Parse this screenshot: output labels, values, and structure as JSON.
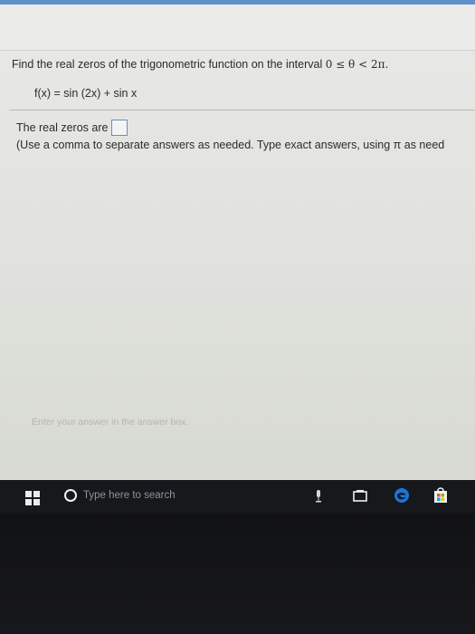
{
  "question": {
    "prefix": "Find the real zeros of the trigonometric function on the interval ",
    "interval": "0 ≤ θ < 2π."
  },
  "function_text": "f(x) = sin (2x) + sin x",
  "answer": {
    "label": "The real zeros are",
    "box_value": ""
  },
  "instructions": "(Use a comma to separate answers as needed. Type exact answers, using π as need",
  "hint": "Enter your answer in the answer box.",
  "taskbar": {
    "search_placeholder": "Type here to search"
  },
  "colors": {
    "page_background": "#e6e6e4",
    "top_accent": "#5f8fc9",
    "taskbar": "#16181c",
    "edge_blue": "#1d74d8"
  },
  "icons": {
    "windows_start": "windows-start-icon",
    "search": "search-icon",
    "microphone": "microphone-icon",
    "task_view": "task-view-icon",
    "edge": "edge-icon",
    "store": "store-icon"
  }
}
